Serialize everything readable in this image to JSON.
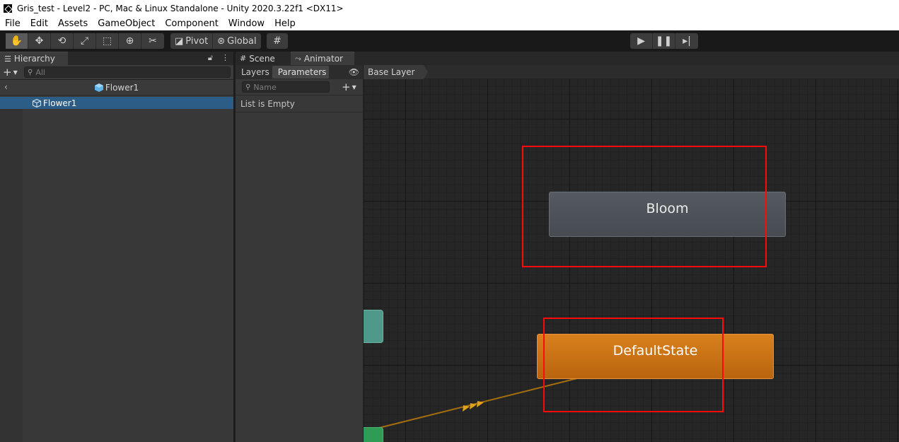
{
  "window": {
    "title": "Gris_test - Level2 - PC, Mac & Linux Standalone - Unity 2020.3.22f1 <DX11>"
  },
  "menu": [
    "File",
    "Edit",
    "Assets",
    "GameObject",
    "Component",
    "Window",
    "Help"
  ],
  "toolbar": {
    "tools": [
      "hand-icon",
      "move-icon",
      "rotate-icon",
      "scale-icon",
      "rect-tool-icon",
      "transform-icon",
      "custom-tool-icon"
    ],
    "pivot_label": "Pivot",
    "global_label": "Global",
    "play": "play-icon",
    "pause": "pause-icon",
    "step": "step-icon"
  },
  "hierarchy": {
    "tab_label": "Hierarchy",
    "search_placeholder": "All",
    "scene_name": "Flower1",
    "items": [
      {
        "label": "Flower1",
        "selected": true
      }
    ]
  },
  "animator_tabs": [
    {
      "label": "Scene",
      "icon": "grid-icon",
      "active": false
    },
    {
      "label": "Animator",
      "icon": "animator-icon",
      "active": true
    }
  ],
  "parameters_panel": {
    "tabs": [
      "Layers",
      "Parameters"
    ],
    "active_tab": "Parameters",
    "search_placeholder": "Name",
    "empty_text": "List is Empty"
  },
  "graph": {
    "breadcrumb": "Base Layer",
    "states": [
      {
        "name": "Bloom",
        "color": "#4b4f56"
      },
      {
        "name": "DefaultState",
        "color": "#c8720f"
      }
    ],
    "entry_color": "#4e998a",
    "any_state_color": "#2e9c55",
    "transition_color": "#a7700f",
    "highlight_color": "#ff0a0a"
  }
}
